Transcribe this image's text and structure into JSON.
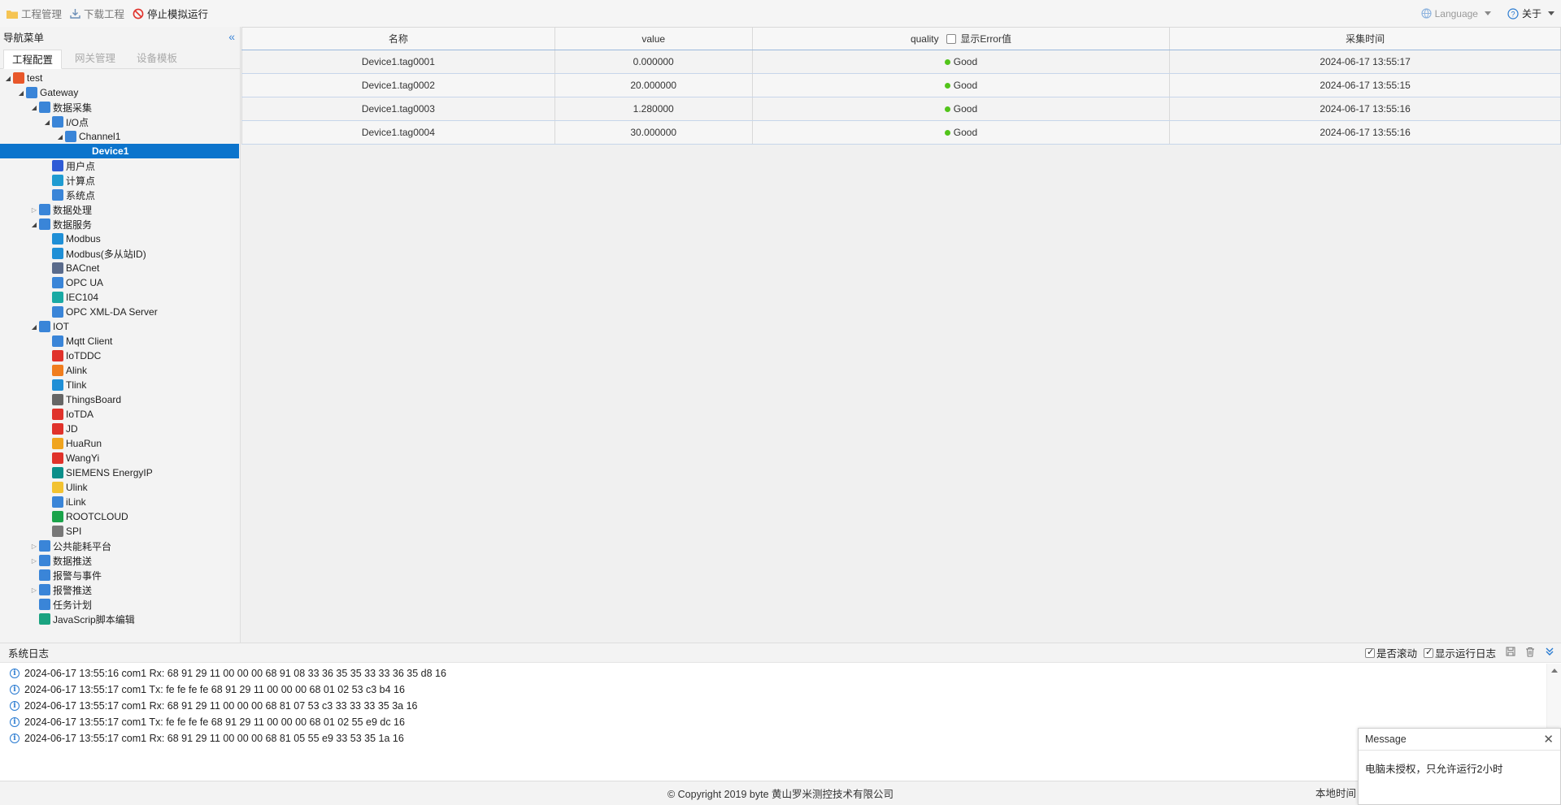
{
  "toolbar": {
    "project_mgmt": "工程管理",
    "download_project": "下载工程",
    "stop_simulation": "停止模拟运行",
    "language": "Language",
    "about": "关于"
  },
  "nav": {
    "title": "导航菜单",
    "tabs": [
      "工程配置",
      "网关管理",
      "设备模板"
    ],
    "tree": [
      {
        "label": "test",
        "level": 0,
        "toggle": "open",
        "icon": "stack-icon",
        "color": "#e8572a"
      },
      {
        "label": "Gateway",
        "level": 1,
        "toggle": "open",
        "icon": "gateway-icon",
        "color": "#3a85d8"
      },
      {
        "label": "数据采集",
        "level": 2,
        "toggle": "open",
        "icon": "data-collect-icon",
        "color": "#3a85d8"
      },
      {
        "label": "I/O点",
        "level": 3,
        "toggle": "open",
        "icon": "io-icon",
        "color": "#3a85d8"
      },
      {
        "label": "Channel1",
        "level": 4,
        "toggle": "open",
        "icon": "channel-icon",
        "color": "#3a85d8"
      },
      {
        "label": "Device1",
        "level": 5,
        "toggle": "none",
        "icon": "device-icon",
        "color": "#0c74cc",
        "selected": true
      },
      {
        "label": "用户点",
        "level": 3,
        "toggle": "none",
        "icon": "user-point-icon",
        "color": "#2f5bd6"
      },
      {
        "label": "计算点",
        "level": 3,
        "toggle": "none",
        "icon": "calc-point-icon",
        "color": "#1f9bd1"
      },
      {
        "label": "系统点",
        "level": 3,
        "toggle": "none",
        "icon": "system-point-icon",
        "color": "#3a85d8"
      },
      {
        "label": "数据处理",
        "level": 2,
        "toggle": "closed",
        "icon": "data-process-icon",
        "color": "#3a85d8"
      },
      {
        "label": "数据服务",
        "level": 2,
        "toggle": "open",
        "icon": "data-service-icon",
        "color": "#3a85d8"
      },
      {
        "label": "Modbus",
        "level": 3,
        "toggle": "none",
        "icon": "modbus-icon",
        "color": "#1f8fd6"
      },
      {
        "label": "Modbus(多从站ID)",
        "level": 3,
        "toggle": "none",
        "icon": "modbus-multi-icon",
        "color": "#1f8fd6"
      },
      {
        "label": "BACnet",
        "level": 3,
        "toggle": "none",
        "icon": "bacnet-icon",
        "color": "#5a6b8c"
      },
      {
        "label": "OPC UA",
        "level": 3,
        "toggle": "none",
        "icon": "opcua-icon",
        "color": "#3a85d8"
      },
      {
        "label": "IEC104",
        "level": 3,
        "toggle": "none",
        "icon": "iec104-icon",
        "color": "#19a9a4"
      },
      {
        "label": "OPC XML-DA Server",
        "level": 3,
        "toggle": "none",
        "icon": "opc-xml-icon",
        "color": "#3a85d8"
      },
      {
        "label": "IOT",
        "level": 2,
        "toggle": "open",
        "icon": "iot-icon",
        "color": "#3a85d8"
      },
      {
        "label": "Mqtt Client",
        "level": 3,
        "toggle": "none",
        "icon": "mqtt-icon",
        "color": "#3a85d8"
      },
      {
        "label": "IoTDDC",
        "level": 3,
        "toggle": "none",
        "icon": "iotddc-icon",
        "color": "#e0322b"
      },
      {
        "label": "Alink",
        "level": 3,
        "toggle": "none",
        "icon": "alink-icon",
        "color": "#f07d1e"
      },
      {
        "label": "Tlink",
        "level": 3,
        "toggle": "none",
        "icon": "tlink-icon",
        "color": "#1f8fd6"
      },
      {
        "label": "ThingsBoard",
        "level": 3,
        "toggle": "none",
        "icon": "thingsboard-icon",
        "color": "#666666"
      },
      {
        "label": "IoTDA",
        "level": 3,
        "toggle": "none",
        "icon": "huawei-icon",
        "color": "#e0322b"
      },
      {
        "label": "JD",
        "level": 3,
        "toggle": "none",
        "icon": "jd-icon",
        "color": "#e0322b"
      },
      {
        "label": "HuaRun",
        "level": 3,
        "toggle": "none",
        "icon": "huarun-icon",
        "color": "#f0a41e"
      },
      {
        "label": "WangYi",
        "level": 3,
        "toggle": "none",
        "icon": "wangyi-icon",
        "color": "#e0322b"
      },
      {
        "label": "SIEMENS EnergyIP",
        "level": 3,
        "toggle": "none",
        "icon": "siemens-icon",
        "color": "#0a8f8a"
      },
      {
        "label": "Ulink",
        "level": 3,
        "toggle": "none",
        "icon": "ulink-icon",
        "color": "#f2c230"
      },
      {
        "label": "iLink",
        "level": 3,
        "toggle": "none",
        "icon": "ilink-icon",
        "color": "#3a85d8"
      },
      {
        "label": "ROOTCLOUD",
        "level": 3,
        "toggle": "none",
        "icon": "rootcloud-icon",
        "color": "#1aa34a"
      },
      {
        "label": "SPI",
        "level": 3,
        "toggle": "none",
        "icon": "spi-icon",
        "color": "#777777"
      },
      {
        "label": "公共能耗平台",
        "level": 2,
        "toggle": "closed",
        "icon": "energy-platform-icon",
        "color": "#3a85d8"
      },
      {
        "label": "数据推送",
        "level": 2,
        "toggle": "closed",
        "icon": "data-push-icon",
        "color": "#3a85d8"
      },
      {
        "label": "报警与事件",
        "level": 2,
        "toggle": "none",
        "icon": "bell-icon",
        "color": "#3a85d8"
      },
      {
        "label": "报警推送",
        "level": 2,
        "toggle": "closed",
        "icon": "alarm-push-icon",
        "color": "#3a85d8"
      },
      {
        "label": "任务计划",
        "level": 2,
        "toggle": "none",
        "icon": "task-plan-icon",
        "color": "#3a85d8"
      },
      {
        "label": "JavaScrip脚本编辑",
        "level": 2,
        "toggle": "none",
        "icon": "script-icon",
        "color": "#1aa380"
      }
    ]
  },
  "table": {
    "headers": {
      "name": "名称",
      "value": "value",
      "quality": "quality",
      "show_error": "显示Error值",
      "time": "采集时间"
    },
    "rows": [
      {
        "name": "Device1.tag0001",
        "value": "0.000000",
        "quality": "Good",
        "time": "2024-06-17 13:55:17"
      },
      {
        "name": "Device1.tag0002",
        "value": "20.000000",
        "quality": "Good",
        "time": "2024-06-17 13:55:15"
      },
      {
        "name": "Device1.tag0003",
        "value": "1.280000",
        "quality": "Good",
        "time": "2024-06-17 13:55:16"
      },
      {
        "name": "Device1.tag0004",
        "value": "30.000000",
        "quality": "Good",
        "time": "2024-06-17 13:55:16"
      }
    ]
  },
  "log": {
    "title": "系统日志",
    "auto_scroll": "是否滚动",
    "show_run_log": "显示运行日志",
    "lines": [
      "2024-06-17 13:55:16 com1 Rx: 68 91 29 11 00 00 00 68 91 08 33 36 35 35 33 33 36 35 d8 16",
      "2024-06-17 13:55:17 com1 Tx: fe fe fe fe 68 91 29 11 00 00 00 68 01 02 53 c3 b4 16",
      "2024-06-17 13:55:17 com1 Rx: 68 91 29 11 00 00 00 68 81 07 53 c3 33 33 33 35 3a 16",
      "2024-06-17 13:55:17 com1 Tx: fe fe fe fe 68 91 29 11 00 00 00 68 01 02 55 e9 dc 16",
      "2024-06-17 13:55:17 com1 Rx: 68 91 29 11 00 00 00 68 81 05 55 e9 33 53 35 1a 16"
    ]
  },
  "footer": {
    "copyright": "© Copyright 2019 byte 黄山罗米测控技术有限公司",
    "local_time_label": "本地时间"
  },
  "message": {
    "title": "Message",
    "text": "电脑未授权，只允许运行2小时"
  },
  "colors": {
    "accent": "#0c74cc",
    "good": "#52c41a",
    "stop": "#e0322b"
  }
}
